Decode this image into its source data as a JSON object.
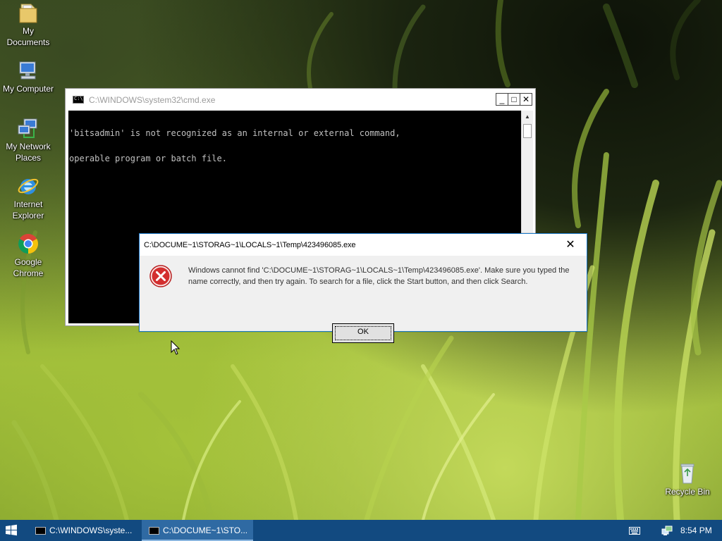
{
  "desktop": {
    "icons": [
      {
        "label": "My Documents",
        "icon": "my-documents-icon"
      },
      {
        "label": "My Computer",
        "icon": "my-computer-icon"
      },
      {
        "label": "My Network Places",
        "icon": "network-places-icon"
      },
      {
        "label": "Internet Explorer",
        "icon": "internet-explorer-icon"
      },
      {
        "label": "Google Chrome",
        "icon": "chrome-icon"
      },
      {
        "label": "Recycle Bin",
        "icon": "recycle-bin-icon"
      }
    ]
  },
  "cmd_window": {
    "title": "C:\\WINDOWS\\system32\\cmd.exe",
    "output_line1": "'bitsadmin' is not recognized as an internal or external command,",
    "output_line2": "operable program or batch file.",
    "minimize_label": "_",
    "maximize_label": "□",
    "close_label": "✕"
  },
  "error_dialog": {
    "title": "C:\\DOCUME~1\\STORAG~1\\LOCALS~1\\Temp\\423496085.exe",
    "message": "Windows cannot find 'C:\\DOCUME~1\\STORAG~1\\LOCALS~1\\Temp\\423496085.exe'. Make sure you typed the name correctly, and then try again. To search for a file, click the Start button, and then click Search.",
    "ok_label": "OK",
    "close_label": "✕",
    "icon": "error-icon"
  },
  "taskbar": {
    "tasks": [
      {
        "label": "C:\\WINDOWS\\syste...",
        "active": false
      },
      {
        "label": "C:\\DOCUME~1\\STO...",
        "active": true
      }
    ],
    "clock": "8:54 PM"
  },
  "colors": {
    "taskbar": "#124a80",
    "dialog_border": "#1979ca",
    "error_red": "#d32f2f"
  }
}
